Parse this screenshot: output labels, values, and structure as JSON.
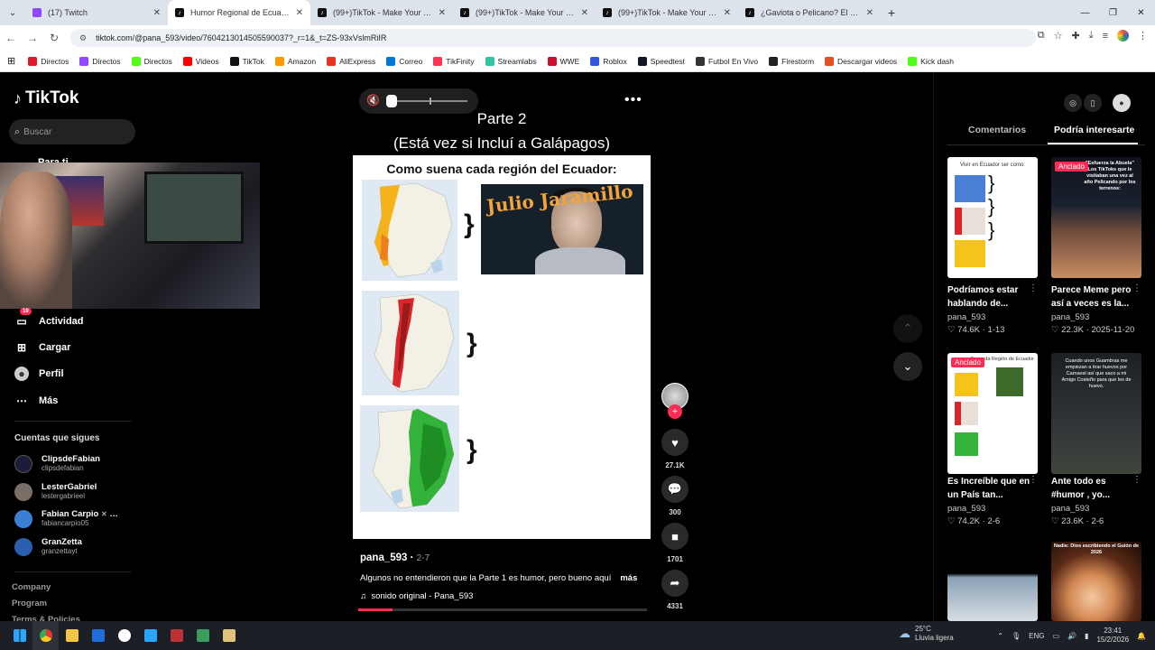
{
  "browser": {
    "tabs": [
      {
        "title": "(17) Twitch",
        "icon": "twitch-icon",
        "active": false
      },
      {
        "title": "Humor Regional de Ecuador: Pa",
        "icon": "tiktok-icon",
        "active": true
      },
      {
        "title": "(99+)TikTok - Make Your Day",
        "icon": "tiktok-icon",
        "active": false
      },
      {
        "title": "(99+)TikTok - Make Your Day",
        "icon": "tiktok-icon",
        "active": false
      },
      {
        "title": "(99+)TikTok - Make Your Day",
        "icon": "tiktok-icon",
        "active": false
      },
      {
        "title": "¿Gaviota o Pelicano? El Debate",
        "icon": "tiktok-icon",
        "active": false
      }
    ],
    "url": "tiktok.com/@pana_593/video/7604213014505590037?_r=1&_t=ZS-93xVslmRiIR",
    "bookmarks": [
      {
        "label": "Directos",
        "color": "#e0182d"
      },
      {
        "label": "Directos",
        "color": "#9146ff"
      },
      {
        "label": "Directos",
        "color": "#53fc18"
      },
      {
        "label": "Videos",
        "color": "#ff0000"
      },
      {
        "label": "TikTok",
        "color": "#111111"
      },
      {
        "label": "Amazon",
        "color": "#ff9900"
      },
      {
        "label": "AliExpress",
        "color": "#e43225"
      },
      {
        "label": "Correo",
        "color": "#0078d4"
      },
      {
        "label": "TikFinity",
        "color": "#ff3355"
      },
      {
        "label": "Streamlabs",
        "color": "#31c3a2"
      },
      {
        "label": "WWE",
        "color": "#c8102e"
      },
      {
        "label": "Roblox",
        "color": "#3355dd"
      },
      {
        "label": "Speedtest",
        "color": "#141526"
      },
      {
        "label": "Futbol En Vivo",
        "color": "#333333"
      },
      {
        "label": "Firestorm",
        "color": "#222222"
      },
      {
        "label": "Descargar videos",
        "color": "#e05020"
      },
      {
        "label": "Kick dash",
        "color": "#53fc18"
      }
    ]
  },
  "sidebar": {
    "logo": "TikTok",
    "search_placeholder": "Buscar",
    "partial_item": "Para ti",
    "activity_badge": "19",
    "menu": [
      {
        "label": "Actividad",
        "icon": "inbox-icon"
      },
      {
        "label": "Cargar",
        "icon": "upload-icon"
      },
      {
        "label": "Perfil",
        "icon": "profile-icon"
      },
      {
        "label": "Más",
        "icon": "more-icon"
      }
    ],
    "following_title": "Cuentas que sigues",
    "accounts": [
      {
        "name": "ClipsdeFabian",
        "handle": "clipsdefabian",
        "color": "#1b1b3a"
      },
      {
        "name": "LesterGabriel",
        "handle": "lestergabrieel",
        "color": "#7a6f66"
      },
      {
        "name": "Fabian Carpio",
        "handle": "fabiancarpio05",
        "color": "#3b7fd4"
      },
      {
        "name": "GranZetta",
        "handle": "granzettayt",
        "color": "#2a5fb0"
      }
    ],
    "footer": [
      "Company",
      "Program",
      "Terms & Policies"
    ]
  },
  "video": {
    "title_line1": "Parte 2",
    "title_line2": "(Está vez si Incluí a Galápagos)",
    "card_title": "Como suena cada región del Ecuador:",
    "image_caption": "Julio Jaramillo",
    "author": "pana_593",
    "date": "2-7",
    "description": "Algunos no entendieron que la Parte 1 es humor, pero bueno aquí",
    "more": "más",
    "sound": "sonido original - Pana_593",
    "progress": 0.12,
    "likes": "27.1K",
    "comments": "300",
    "saves": "1701",
    "shares": "4331"
  },
  "right_panel": {
    "tab_comments": "Comentarios",
    "tab_interesting": "Podría interesarte",
    "pinned_label": "Anclado",
    "videos": [
      {
        "title": "Podríamos estar hablando de...",
        "author": "pana_593",
        "likes": "74.6K",
        "date": "1-13",
        "pinned": false,
        "caption": "Vivir en Ecuador ser como:"
      },
      {
        "title": "Parece Meme pero así a veces es la...",
        "author": "pana_593",
        "likes": "22.3K",
        "date": "2025-11-20",
        "pinned": true,
        "caption": "\"Esfuerza la Abuela\" Los TikToks que le visitaban una vez al año Pelicando por los terrenos:"
      },
      {
        "title": "Es Increíble que en un País tan...",
        "author": "pana_593",
        "likes": "74.2K",
        "date": "2-6",
        "pinned": true,
        "caption": "Por cada Región de Ecuador"
      },
      {
        "title": "Ante todo es #humor , yo...",
        "author": "pana_593",
        "likes": "23.6K",
        "date": "2-6",
        "pinned": false,
        "caption": "Cuando unos Guambras me empiezan a tirar huevos por Carnaval así que saco a mi Amigo Costeño para que les de huevo."
      },
      {
        "title": "",
        "author": "",
        "likes": "",
        "date": "",
        "pinned": false,
        "caption": ""
      },
      {
        "title": "",
        "author": "",
        "likes": "",
        "date": "",
        "pinned": false,
        "caption": "Nadie: Dios escribiendo el Guión de 2026"
      }
    ]
  },
  "taskbar": {
    "temp": "25°C",
    "weather": "Lluvia ligera",
    "lang": "ENG",
    "time": "23:41",
    "date": "15/2/2026"
  }
}
